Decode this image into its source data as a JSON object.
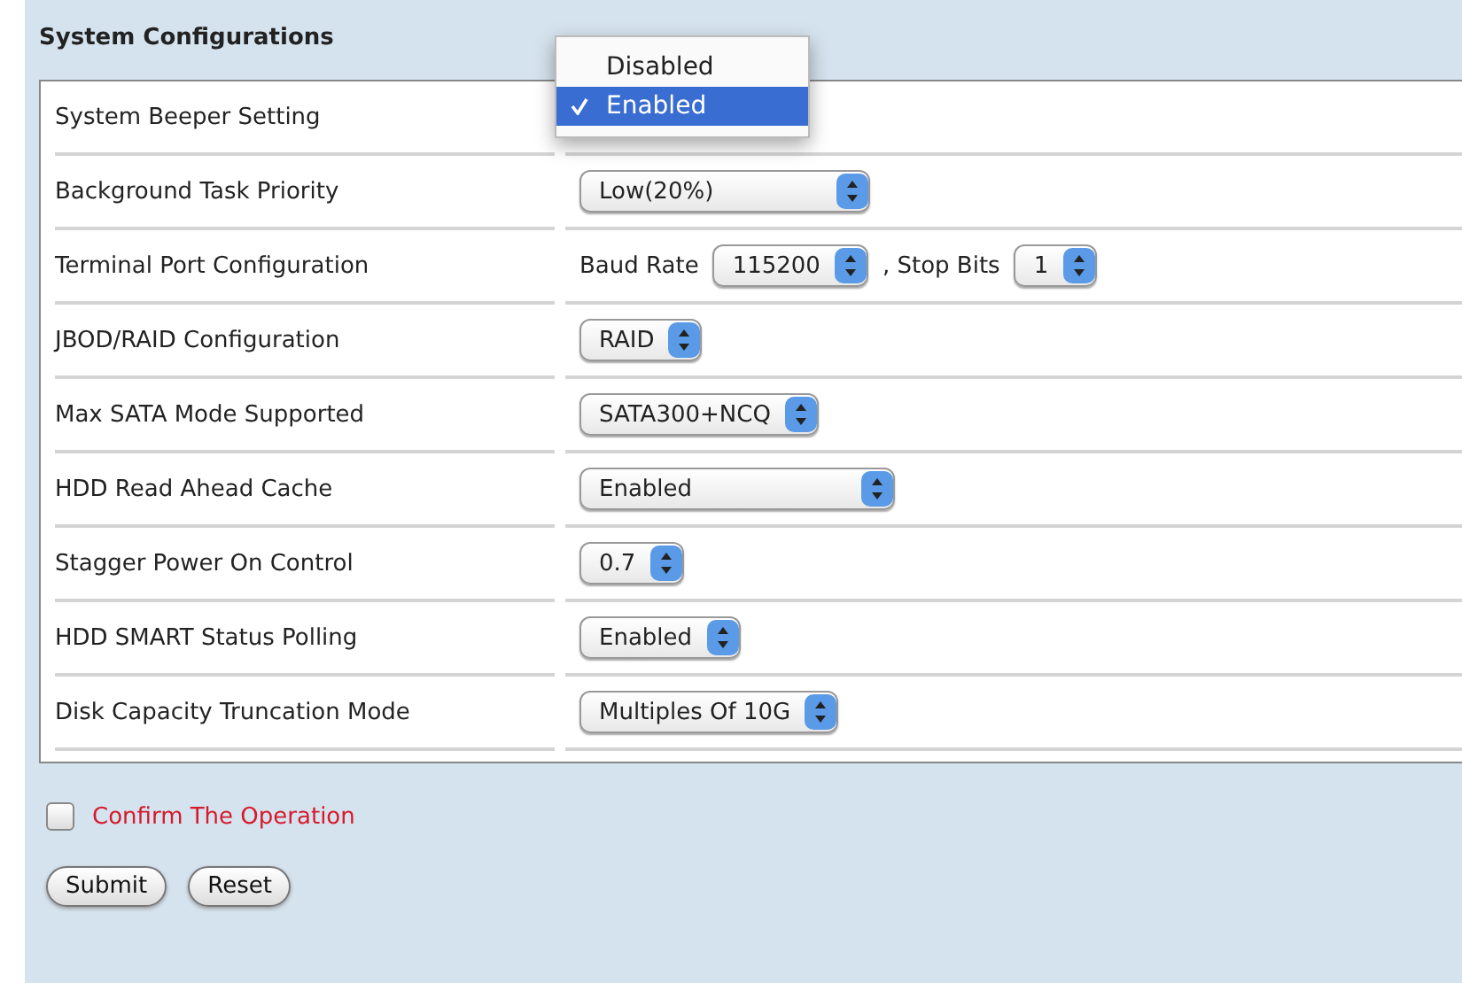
{
  "title": "System Configurations",
  "rows": [
    {
      "label": "System Beeper Setting",
      "controls": [],
      "menu": [
        {
          "label": "Disabled",
          "selected": false
        },
        {
          "label": "Enabled",
          "selected": true
        }
      ]
    },
    {
      "label": "Background Task Priority",
      "controls": [
        {
          "kind": "select",
          "value": "Low(20%)"
        }
      ]
    },
    {
      "label": "Terminal Port Configuration",
      "controls": [
        {
          "kind": "text",
          "value": "Baud Rate"
        },
        {
          "kind": "select",
          "value": "115200"
        },
        {
          "kind": "text",
          "value": ", Stop Bits"
        },
        {
          "kind": "select",
          "value": "1"
        }
      ]
    },
    {
      "label": "JBOD/RAID Configuration",
      "controls": [
        {
          "kind": "select",
          "value": "RAID"
        }
      ]
    },
    {
      "label": "Max SATA Mode Supported",
      "controls": [
        {
          "kind": "select",
          "value": "SATA300+NCQ"
        }
      ]
    },
    {
      "label": "HDD Read Ahead Cache",
      "controls": [
        {
          "kind": "select",
          "value": "Enabled"
        }
      ]
    },
    {
      "label": "Stagger Power On Control",
      "controls": [
        {
          "kind": "select",
          "value": "0.7"
        }
      ]
    },
    {
      "label": "HDD SMART Status Polling",
      "controls": [
        {
          "kind": "select",
          "value": "Enabled"
        }
      ]
    },
    {
      "label": "Disk Capacity Truncation Mode",
      "controls": [
        {
          "kind": "select",
          "value": "Multiples Of 10G"
        }
      ]
    }
  ],
  "confirm": {
    "label": "Confirm The Operation",
    "checked": false
  },
  "buttons": [
    "Submit",
    "Reset"
  ]
}
